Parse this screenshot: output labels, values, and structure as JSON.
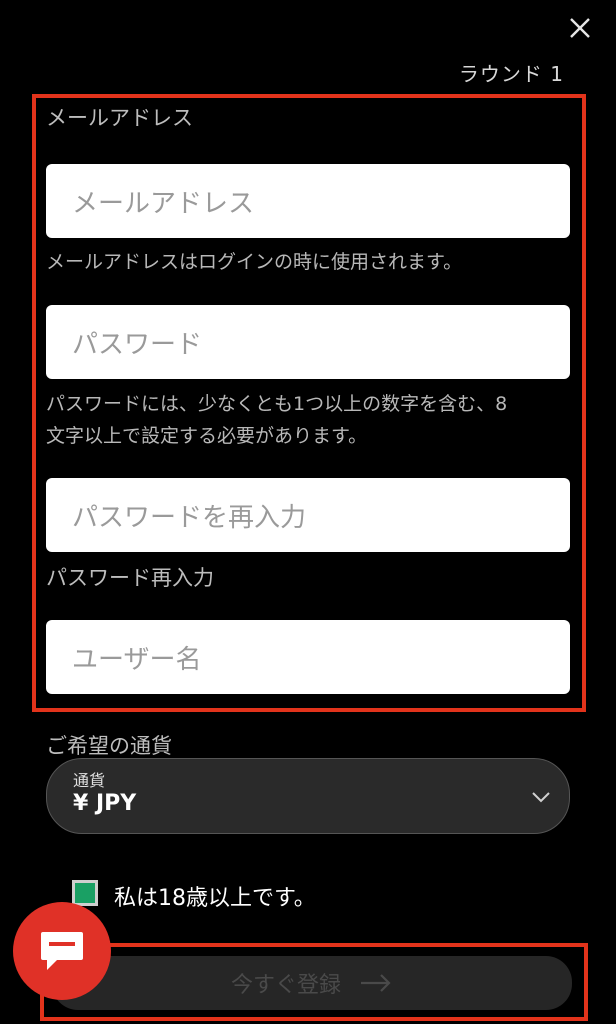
{
  "header": {
    "close_icon": "close-icon",
    "round_label": "ラウンド 1"
  },
  "form": {
    "email_section_label": "メールアドレス",
    "email_placeholder": "メールアドレス",
    "email_helper": "メールアドレスはログインの時に使用されます。",
    "password_placeholder": "パスワード",
    "password_helper_line1": "パスワードには、少なくとも1つ以上の数字を含む、8",
    "password_helper_line2": "文字以上で設定する必要があります。",
    "password_confirm_placeholder": "パスワードを再入力",
    "password_confirm_helper": "パスワード再入力",
    "username_placeholder": "ユーザー名"
  },
  "currency": {
    "section_label": "ご希望の通貨",
    "caption": "通貨",
    "value": "¥ JPY",
    "icon": "chevron-down-icon"
  },
  "age_check": {
    "checked": true,
    "label": "私は18歳以上です。"
  },
  "submit": {
    "label": "今すぐ登録",
    "icon": "arrow-right-icon"
  },
  "chat": {
    "icon": "chat-bubble-icon"
  },
  "colors": {
    "highlight_border": "#e2331b",
    "checkbox_fill": "#1aa064",
    "chat_button": "#e03127",
    "background": "#000000"
  }
}
